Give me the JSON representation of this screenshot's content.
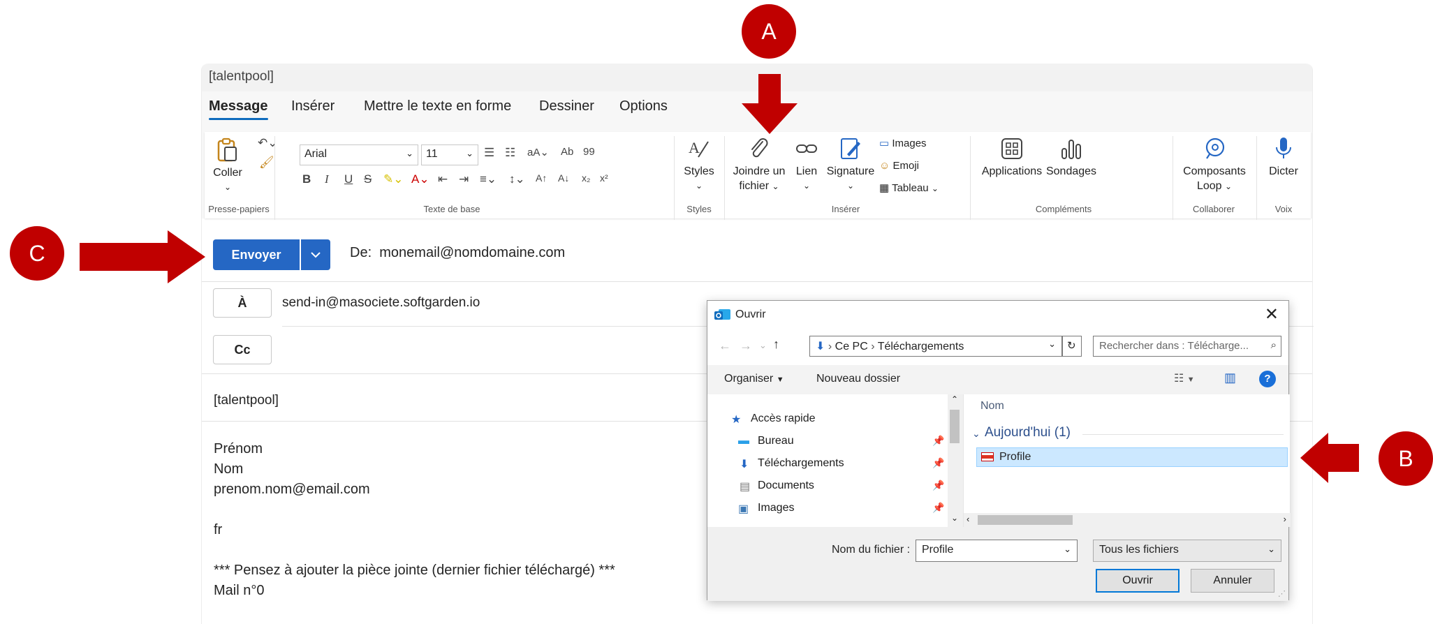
{
  "window": {
    "title": "[talentpool]"
  },
  "tabs": [
    "Message",
    "Insérer",
    "Mettre le texte en forme",
    "Dessiner",
    "Options"
  ],
  "ribbon": {
    "clipboard": {
      "paste": "Coller",
      "group": "Presse-papiers"
    },
    "font": {
      "name": "Arial",
      "size": "11",
      "group": "Texte de base"
    },
    "styles": {
      "label": "Styles",
      "group": "Styles"
    },
    "insert": {
      "attach_l1": "Joindre un",
      "attach_l2": "fichier",
      "link": "Lien",
      "signature": "Signature",
      "images": "Images",
      "emoji": "Emoji",
      "table": "Tableau",
      "group": "Insérer"
    },
    "addins": {
      "apps": "Applications",
      "polls": "Sondages",
      "group": "Compléments"
    },
    "collab": {
      "loop_l1": "Composants",
      "loop_l2": "Loop",
      "group": "Collaborer"
    },
    "voice": {
      "dictate": "Dicter",
      "group": "Voix"
    }
  },
  "compose": {
    "send": "Envoyer",
    "from_label": "De:",
    "from_value": "monemail@nomdomaine.com",
    "to_label": "À",
    "to_value": "send-in@masociete.softgarden.io",
    "cc_label": "Cc",
    "subject": "[talentpool]",
    "body": [
      "Prénom",
      "Nom",
      "prenom.nom@email.com",
      "",
      "fr",
      "",
      "*** Pensez à ajouter la pièce jointe (dernier fichier téléchargé) ***",
      "Mail n°0"
    ]
  },
  "dialog": {
    "title": "Ouvrir",
    "path_root": "Ce PC",
    "path_folder": "Téléchargements",
    "search_placeholder": "Rechercher dans : Télécharge...",
    "organize": "Organiser",
    "new_folder": "Nouveau dossier",
    "nav": {
      "quick_access": "Accès rapide",
      "items": [
        "Bureau",
        "Téléchargements",
        "Documents",
        "Images"
      ]
    },
    "column_name": "Nom",
    "group_today": "Aujourd'hui (1)",
    "file": "Profile",
    "filename_label": "Nom du fichier :",
    "filename_value": "Profile",
    "filter": "Tous les fichiers",
    "open": "Ouvrir",
    "cancel": "Annuler"
  },
  "annotations": {
    "a": "A",
    "b": "B",
    "c": "C"
  },
  "colors": {
    "accent": "#2567c4",
    "annotation": "#c00000",
    "selection": "#cce8ff"
  }
}
